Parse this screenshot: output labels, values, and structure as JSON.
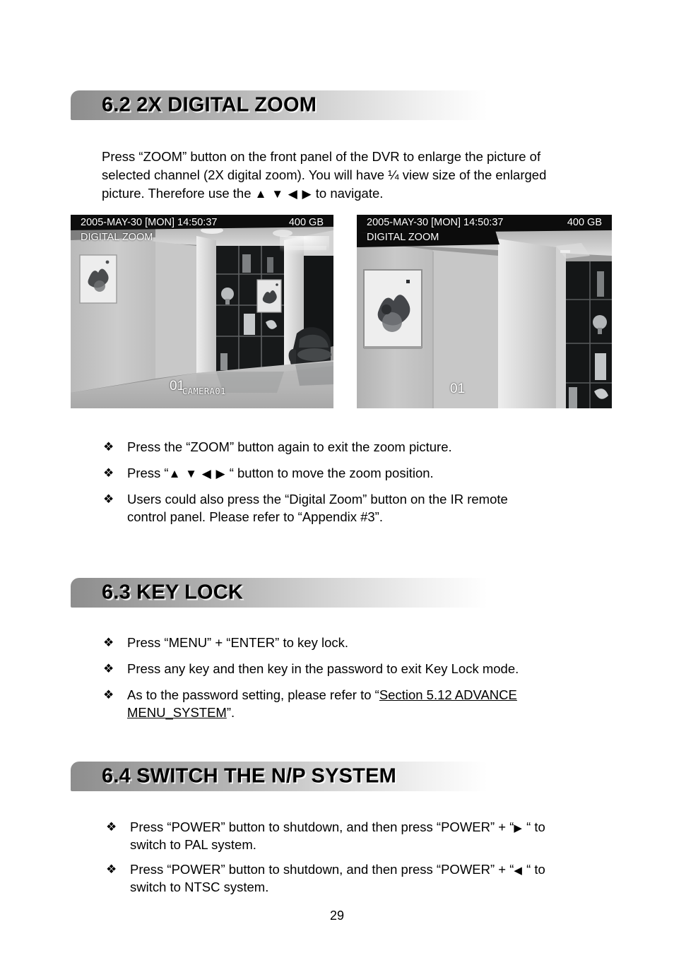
{
  "page": {
    "number": "29"
  },
  "sections": [
    {
      "id": "digital-zoom",
      "heading": "6.2 2X DIGITAL ZOOM",
      "paragraph_line1": "Press “ZOOM” button on the front panel of the DVR to enlarge the picture of",
      "paragraph_line2": "selected channel (2X digital zoom). You will have ¼ view size of the enlarged",
      "paragraph_line3_pre": "picture. Therefore use the ",
      "paragraph_arrows": "▲ ▼  ◀  ▶",
      "paragraph_line3_post": " to navigate.",
      "bullets": [
        {
          "text": "Press the “ZOOM” button again to exit the zoom picture."
        },
        {
          "pre": "Press “",
          "arrows": "▲ ▼  ◀  ▶",
          "post": " “ button to move the zoom position."
        },
        {
          "text": "Users could also press the “Digital Zoom” button on the IR remote",
          "text2": "control panel. Please refer to “Appendix #3”."
        }
      ]
    },
    {
      "id": "key-lock",
      "heading": "6.3 KEY LOCK",
      "bullets": [
        {
          "text": "Press “MENU” + “ENTER” to key lock."
        },
        {
          "text": "Press any key and then key in the password to exit Key Lock mode."
        },
        {
          "pre": "As to the password setting, please refer to “",
          "link1": "Section 5.12 ADVANCE",
          "link2": "MENU_SYSTEM",
          "post": "”."
        }
      ]
    },
    {
      "id": "switch-np-system",
      "heading": "6.4 SWITCH THE N/P SYSTEM",
      "bullets": [
        {
          "pre": "Press “POWER” button to shutdown, and then press “POWER” + “",
          "arrows": "▶",
          "post": " “ to",
          "text2": "switch to PAL system."
        },
        {
          "pre": "Press “POWER” button to shutdown, and then press “POWER” + “",
          "arrows": "◀",
          "post": " “ to",
          "text2": "switch to NTSC system."
        }
      ]
    }
  ],
  "screenshots": [
    {
      "id": "normal-view",
      "osd_datetime": "2005-MAY-30 [MON]  14:50:37",
      "osd_hdd": "400 GB",
      "osd_mode": "DIGITAL ZOOM",
      "osd_channel": "01",
      "osd_camera": "CAMERA01"
    },
    {
      "id": "zoomed-view",
      "osd_datetime": "2005-MAY-30 [MON]  14:50:37",
      "osd_hdd": "400 GB",
      "osd_mode": "DIGITAL ZOOM",
      "osd_channel": "01",
      "osd_camera": ""
    }
  ],
  "colors": {
    "bar_start": "#8d8d8d",
    "bar_end": "#ffffff",
    "text": "#000000",
    "osd_text": "#ffffff"
  }
}
